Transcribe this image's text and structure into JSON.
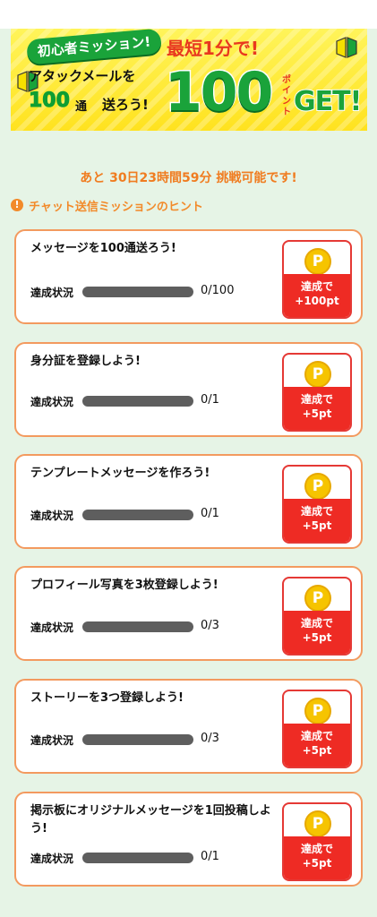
{
  "banner": {
    "badge": "初心者ミッション!",
    "line1": "アタックメールを",
    "count": "100",
    "unit": "通",
    "send": "送ろう!",
    "shortest": "最短1分で!",
    "points": "100",
    "points_unit": "ポイント",
    "get": "GET!"
  },
  "countdown": "あと 30日23時間59分 挑戦可能です!",
  "hint": {
    "icon": "!",
    "label": "チャット送信ミッションのヒント"
  },
  "status_label": "達成状況",
  "missions": [
    {
      "title": "メッセージを100通送ろう!",
      "progress": "0/100",
      "progress_fraction": 0,
      "reward_line1": "達成で",
      "reward_line2": "+100pt"
    },
    {
      "title": "身分証を登録しよう!",
      "progress": "0/1",
      "progress_fraction": 0,
      "reward_line1": "達成で",
      "reward_line2": "+5pt"
    },
    {
      "title": "テンプレートメッセージを作ろう!",
      "progress": "0/1",
      "progress_fraction": 0,
      "reward_line1": "達成で",
      "reward_line2": "+5pt"
    },
    {
      "title": "プロフィール写真を3枚登録しよう!",
      "progress": "0/3",
      "progress_fraction": 0,
      "reward_line1": "達成で",
      "reward_line2": "+5pt"
    },
    {
      "title": "ストーリーを3つ登録しよう!",
      "progress": "0/3",
      "progress_fraction": 0,
      "reward_line1": "達成で",
      "reward_line2": "+5pt"
    },
    {
      "title": "掲示板にオリジナルメッセージを1回投稿しよう!",
      "progress": "0/1",
      "progress_fraction": 0,
      "reward_line1": "達成で",
      "reward_line2": "+5pt"
    }
  ],
  "coin_symbol": "P",
  "colors": {
    "accent_orange": "#f28a2a",
    "reward_red": "#ee2b24",
    "brand_green": "#1aa33a",
    "banner_yellow": "#ffe21f",
    "background": "#e6f4e6"
  }
}
